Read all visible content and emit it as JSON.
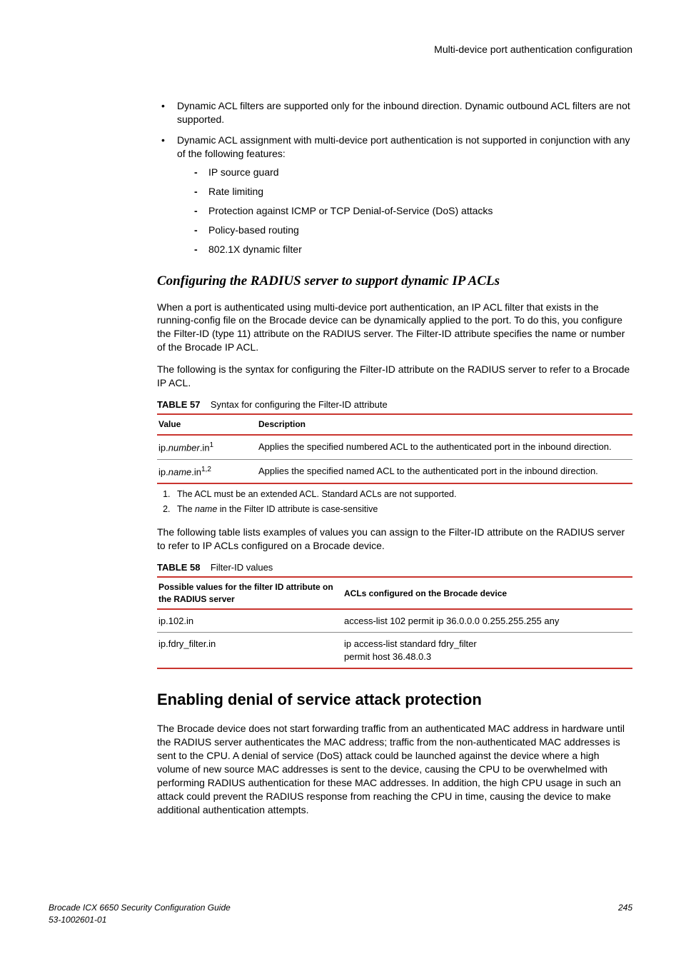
{
  "header": {
    "title": "Multi-device port authentication configuration"
  },
  "bullets": [
    {
      "text": "Dynamic ACL filters are supported only for the inbound direction. Dynamic outbound ACL filters are not supported."
    },
    {
      "text": "Dynamic ACL assignment with multi-device port authentication is not supported in conjunction with any of the following features:",
      "sub": [
        "IP source guard",
        "Rate limiting",
        "Protection against ICMP or TCP Denial-of-Service (DoS) attacks",
        "Policy-based routing",
        "802.1X dynamic filter"
      ]
    }
  ],
  "subhead1": "Configuring the RADIUS server to support dynamic IP ACLs",
  "para1": "When a port is authenticated using multi-device port authentication, an IP ACL filter that exists in the running-config file on the Brocade device can be dynamically applied to the port. To do this, you configure the Filter-ID (type 11) attribute on the RADIUS server. The Filter-ID attribute specifies the name or number of the Brocade IP ACL.",
  "para2": "The following is the syntax for configuring the Filter-ID attribute on the RADIUS server to refer to a Brocade IP ACL.",
  "table57": {
    "label": "TABLE 57",
    "caption": "Syntax for configuring the Filter-ID attribute",
    "head_value": "Value",
    "head_desc": "Description",
    "rows": [
      {
        "value_pre": "ip.",
        "value_it": "number",
        "value_post": ".in",
        "sup": "1",
        "desc": "Applies the specified numbered ACL to the authenticated port in the inbound direction."
      },
      {
        "value_pre": "ip.",
        "value_it": "name",
        "value_post": ".in",
        "sup": "1,2",
        "desc": "Applies the specified named ACL to the authenticated port in the inbound direction."
      }
    ]
  },
  "footnotes": {
    "fn1": "The ACL must be an extended ACL. Standard ACLs are not supported.",
    "fn2_pre": "The ",
    "fn2_it": "name",
    "fn2_post": " in the Filter ID attribute is case-sensitive"
  },
  "para3": "The following table lists examples of values you can assign to the Filter-ID attribute on the RADIUS server to refer to IP ACLs configured on a Brocade device.",
  "table58": {
    "label": "TABLE 58",
    "caption": "Filter-ID values",
    "head_value": "Possible values for the filter ID attribute on the RADIUS server",
    "head_desc": "ACLs configured on the Brocade device",
    "rows": [
      {
        "value": "ip.102.in",
        "desc": "access-list 102 permit ip 36.0.0.0 0.255.255.255 any"
      },
      {
        "value": "ip.fdry_filter.in",
        "desc": "ip access-list standard fdry_filter\npermit host 36.48.0.3"
      }
    ]
  },
  "mainhead": "Enabling denial of service attack protection",
  "para4": "The Brocade device does not start forwarding traffic from an authenticated MAC address in hardware until the RADIUS server authenticates the MAC address; traffic from the non-authenticated MAC addresses is sent to the CPU. A denial of service (DoS) attack could be launched against the device where a high volume of new source MAC addresses is sent to the device, causing the CPU to be overwhelmed with performing RADIUS authentication for these MAC addresses. In addition, the high CPU usage in such an attack could prevent the RADIUS response from reaching the CPU in time, causing the device to make additional authentication attempts.",
  "footer": {
    "left1": "Brocade ICX 6650 Security Configuration Guide",
    "left2": "53-1002601-01",
    "right": "245"
  }
}
